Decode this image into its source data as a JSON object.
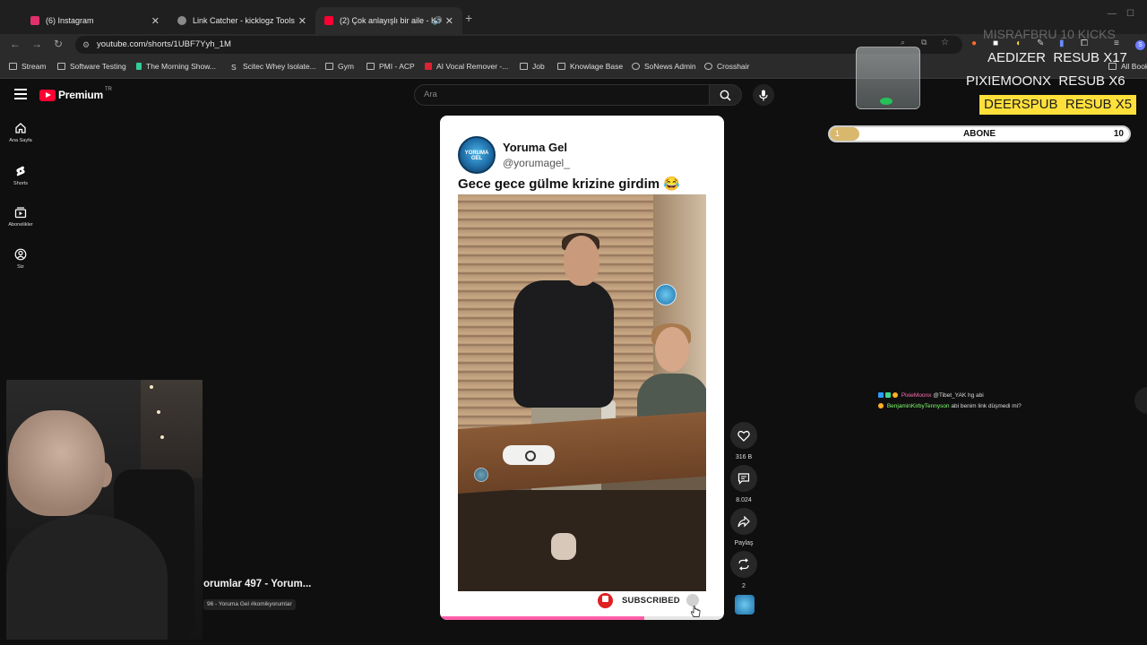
{
  "browser": {
    "tabs": [
      {
        "title": "(6) Instagram",
        "active": false,
        "color": "#e1306c"
      },
      {
        "title": "Link Catcher - kicklogz Tools",
        "active": false,
        "color": "#8a8a8a"
      },
      {
        "title": "(2) Çok anlayışlı bir aile - Ko",
        "active": true,
        "color": "#ff0033"
      }
    ],
    "url": "youtube.com/shorts/1UBF7Yyh_1M",
    "bookmarks": [
      "Stream",
      "Software Testing",
      "The Morning Show...",
      "Scitec Whey Isolate...",
      "Gym",
      "PMI - ACP",
      "AI Vocal Remover -...",
      "Job",
      "Knowlage Base",
      "SoNews Admin",
      "Crosshair"
    ],
    "all_bookmarks": "All Bookm"
  },
  "youtube": {
    "brand": "Premium",
    "region": "TR",
    "search_placeholder": "Ara",
    "guide": [
      {
        "label": "Ana Sayfa",
        "icon": "home-icon"
      },
      {
        "label": "Shorts",
        "icon": "shorts-icon"
      },
      {
        "label": "Abonelikler",
        "icon": "subscriptions-icon"
      },
      {
        "label": "Siz",
        "icon": "account-icon"
      }
    ]
  },
  "short": {
    "channel_name": "Yoruma Gel",
    "channel_handle": "@yorumagel_",
    "avatar_text": "YORUMA GEL",
    "caption": "Gece gece gülme krizine girdim 😂",
    "subscribed_label": "SUBSCRIBED",
    "progress_fraction": 0.72
  },
  "actions": [
    {
      "name": "like",
      "label": "316 B"
    },
    {
      "name": "comments",
      "label": "8.024"
    },
    {
      "name": "share",
      "label": "Paylaş"
    },
    {
      "name": "remix",
      "label": "2"
    }
  ],
  "video_title": "orumlar 497 - Yorum...",
  "video_subtitle": "96 - Yoruma Gel #komikyorumlar",
  "overlay": {
    "kicks": "MISRAFBRU  10 KICKS",
    "resubs": [
      {
        "name": "AEDIZER",
        "count": "RESUB X17",
        "highlight": false
      },
      {
        "name": "PIXIEMOONX",
        "count": "RESUB X6",
        "highlight": false
      },
      {
        "name": "DEERSPUB",
        "count": "RESUB X5",
        "highlight": true
      }
    ],
    "goal": {
      "current": "1",
      "label": "ABONE",
      "target": "10",
      "fraction": 0.1
    }
  },
  "chat": [
    {
      "user": "PixieMoonx",
      "user_color": "#ff6fb0",
      "message": "@Tibet_YAK hg abi"
    },
    {
      "user": "BenjaminKirbyTennyson",
      "user_color": "#7dff6b",
      "message": "abi benim link düşmedi mi?"
    }
  ]
}
